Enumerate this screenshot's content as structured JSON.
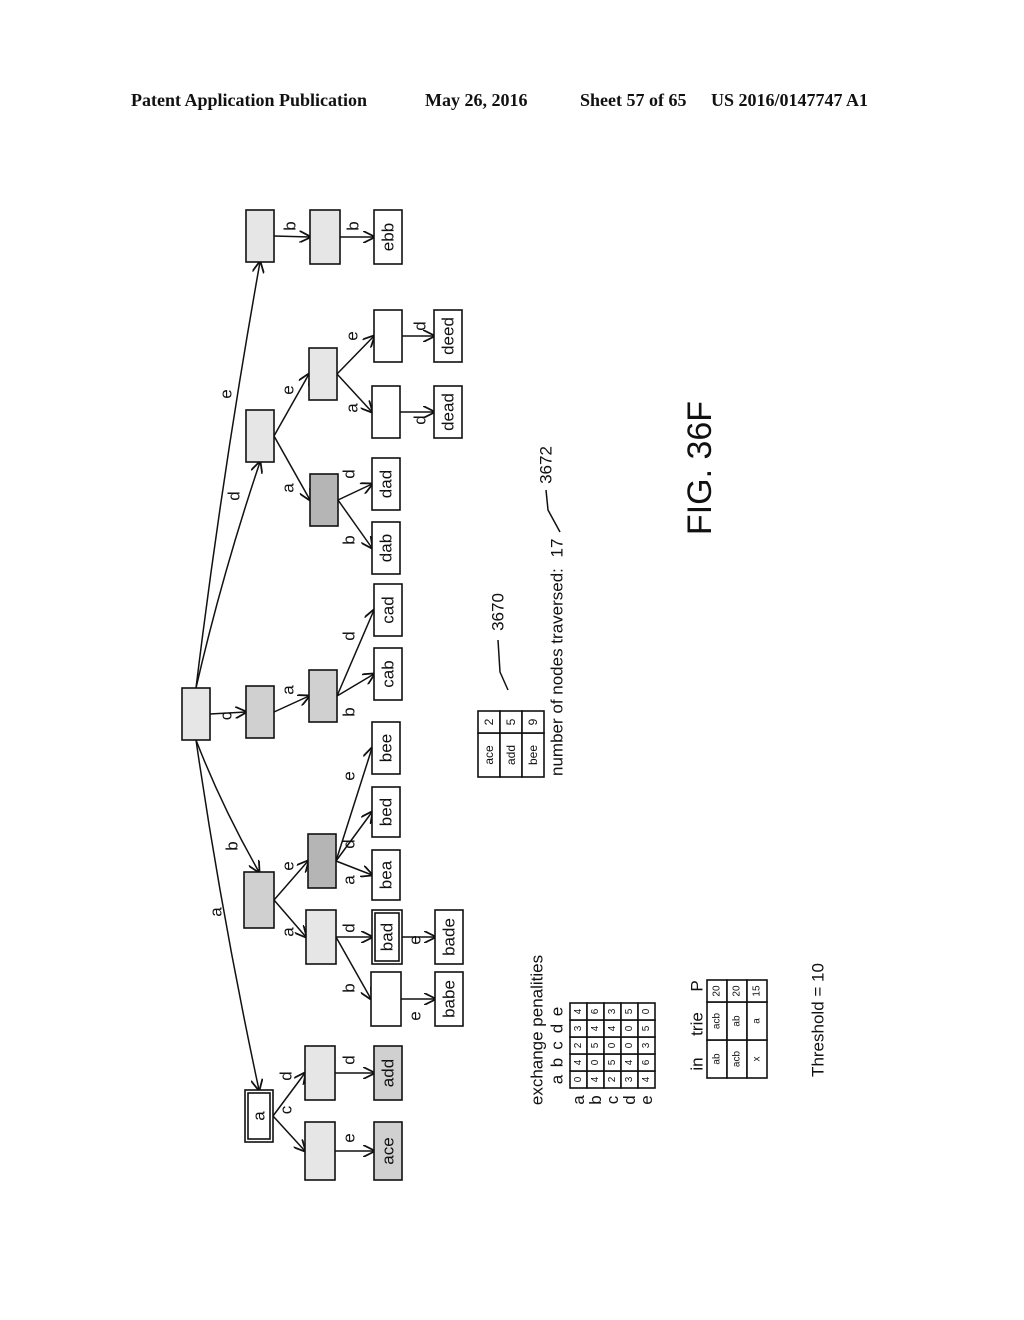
{
  "header": {
    "left": "Patent Application Publication",
    "date": "May 26, 2016",
    "sheet": "Sheet 57 of 65",
    "number": "US 2016/0147747 A1"
  },
  "figure": {
    "label": "FIG. 36F",
    "orientation": "rotated 90 degrees counter-clockwise"
  },
  "trie": {
    "root": {
      "label": "",
      "shading": "light"
    },
    "nodes": [
      {
        "id": "a",
        "label": "a",
        "shading": "none",
        "double_border": true,
        "edge": "a",
        "parent": "root"
      },
      {
        "id": "ac",
        "label": "",
        "shading": "light",
        "edge": "c",
        "parent": "a"
      },
      {
        "id": "ace",
        "label": "ace",
        "shading": "medium",
        "edge": "e",
        "parent": "ac"
      },
      {
        "id": "ad",
        "label": "",
        "shading": "light",
        "edge": "d",
        "parent": "a"
      },
      {
        "id": "add",
        "label": "add",
        "shading": "medium",
        "edge": "d",
        "parent": "ad"
      },
      {
        "id": "b",
        "label": "",
        "shading": "medium",
        "edge": "b",
        "parent": "root"
      },
      {
        "id": "ba",
        "label": "",
        "shading": "light",
        "edge": "a",
        "parent": "b"
      },
      {
        "id": "bab",
        "label": "",
        "shading": "none",
        "edge": "b",
        "parent": "ba"
      },
      {
        "id": "babe",
        "label": "babe",
        "shading": "none",
        "edge": "e",
        "parent": "bab"
      },
      {
        "id": "bad",
        "label": "bad",
        "shading": "none",
        "double_border": true,
        "edge": "d",
        "parent": "ba"
      },
      {
        "id": "bade",
        "label": "bade",
        "shading": "none",
        "edge": "e",
        "parent": "bad"
      },
      {
        "id": "be",
        "label": "",
        "shading": "dark",
        "edge": "e",
        "parent": "b"
      },
      {
        "id": "bea",
        "label": "bea",
        "shading": "none",
        "edge": "a",
        "parent": "be"
      },
      {
        "id": "bed",
        "label": "bed",
        "shading": "none",
        "edge": "d",
        "parent": "be"
      },
      {
        "id": "bee",
        "label": "bee",
        "shading": "none",
        "edge": "e",
        "parent": "be"
      },
      {
        "id": "c",
        "label": "",
        "shading": "medium",
        "edge": "c",
        "parent": "root"
      },
      {
        "id": "ca",
        "label": "",
        "shading": "medium",
        "edge": "a",
        "parent": "c"
      },
      {
        "id": "cab",
        "label": "cab",
        "shading": "none",
        "edge": "b",
        "parent": "ca"
      },
      {
        "id": "cad",
        "label": "cad",
        "shading": "none",
        "edge": "d",
        "parent": "ca"
      },
      {
        "id": "d",
        "label": "",
        "shading": "light",
        "edge": "d",
        "parent": "root"
      },
      {
        "id": "da",
        "label": "",
        "shading": "dark",
        "edge": "a",
        "parent": "d"
      },
      {
        "id": "dab",
        "label": "dab",
        "shading": "none",
        "edge": "b",
        "parent": "da"
      },
      {
        "id": "dad",
        "label": "dad",
        "shading": "none",
        "edge": "d",
        "parent": "da"
      },
      {
        "id": "de",
        "label": "",
        "shading": "light",
        "edge": "e",
        "parent": "d"
      },
      {
        "id": "dea",
        "label": "",
        "shading": "none",
        "edge": "a",
        "parent": "de"
      },
      {
        "id": "dead",
        "label": "dead",
        "shading": "none",
        "edge": "d",
        "parent": "dea"
      },
      {
        "id": "dee",
        "label": "",
        "shading": "none",
        "edge": "e",
        "parent": "de"
      },
      {
        "id": "deed",
        "label": "deed",
        "shading": "none",
        "edge": "d",
        "parent": "dee"
      },
      {
        "id": "e",
        "label": "",
        "shading": "light",
        "edge": "e",
        "parent": "root"
      },
      {
        "id": "eb",
        "label": "",
        "shading": "light",
        "edge": "b",
        "parent": "e"
      },
      {
        "id": "ebb",
        "label": "ebb",
        "shading": "none",
        "edge": "b",
        "parent": "eb"
      }
    ]
  },
  "results_table": {
    "ref": "3670",
    "rows": [
      [
        "ace",
        "2"
      ],
      [
        "add",
        "5"
      ],
      [
        "bee",
        "9"
      ]
    ]
  },
  "nodes_traversed": {
    "label": "number of nodes traversed:",
    "value": "17",
    "ref": "3672"
  },
  "exchange_penalties": {
    "title": "exchange penalities",
    "columns": [
      "a",
      "b",
      "c",
      "d",
      "e"
    ],
    "rows": [
      {
        "label": "a",
        "values": [
          "0",
          "4",
          "2",
          "3",
          "4"
        ]
      },
      {
        "label": "b",
        "values": [
          "4",
          "0",
          "5",
          "4",
          "6"
        ]
      },
      {
        "label": "c",
        "values": [
          "2",
          "5",
          "0",
          "4",
          "3"
        ]
      },
      {
        "label": "d",
        "values": [
          "3",
          "4",
          "0",
          "0",
          "5"
        ]
      },
      {
        "label": "e",
        "values": [
          "4",
          "6",
          "3",
          "5",
          "0"
        ]
      }
    ]
  },
  "in_trie_table": {
    "headers": [
      "in",
      "trie",
      "P"
    ],
    "rows": [
      [
        "ab",
        "acb",
        "20"
      ],
      [
        "acb",
        "ab",
        "20"
      ],
      [
        "x",
        "a",
        "15"
      ]
    ]
  },
  "threshold": "Threshold = 10",
  "colors": {
    "light": "#e6e6e6",
    "medium": "#d0d0d0",
    "dark": "#b5b5b5",
    "none": "#ffffff",
    "ink": "#111111"
  }
}
